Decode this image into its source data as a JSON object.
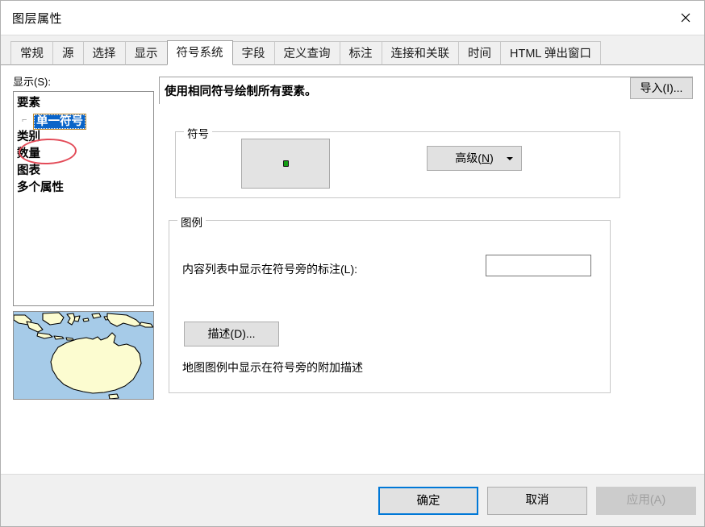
{
  "window": {
    "title": "图层属性",
    "close_icon": "close-icon"
  },
  "tabs": [
    {
      "label": "常规",
      "active": false
    },
    {
      "label": "源",
      "active": false
    },
    {
      "label": "选择",
      "active": false
    },
    {
      "label": "显示",
      "active": false
    },
    {
      "label": "符号系统",
      "active": true
    },
    {
      "label": "字段",
      "active": false
    },
    {
      "label": "定义查询",
      "active": false
    },
    {
      "label": "标注",
      "active": false
    },
    {
      "label": "连接和关联",
      "active": false
    },
    {
      "label": "时间",
      "active": false
    },
    {
      "label": "HTML 弹出窗口",
      "active": false
    }
  ],
  "left_panel": {
    "list_label": "显示(S):",
    "tree": [
      {
        "label": "要素",
        "type": "node",
        "selected": false
      },
      {
        "label": "单一符号",
        "type": "child",
        "selected": true
      },
      {
        "label": "类别",
        "type": "node",
        "selected": false
      },
      {
        "label": "数量",
        "type": "node",
        "selected": false,
        "annotated": true
      },
      {
        "label": "图表",
        "type": "node",
        "selected": false
      },
      {
        "label": "多个属性",
        "type": "node",
        "selected": false
      }
    ],
    "annotation_color": "#e34b58",
    "map_preview": {
      "name": "map-thumbnail",
      "ocean_color": "#a6cbe8",
      "land_color": "#fcfcd0",
      "outline_color": "#000000"
    }
  },
  "main_panel": {
    "render_description": "使用相同符号绘制所有要素。",
    "import_button": "导入(I)...",
    "symbol_group": {
      "title": "符号",
      "symbol_color": "#139d13",
      "symbol_outline": "#141414",
      "advanced_button": "高级(N)",
      "advanced_dropdown_icon": "chevron-down-icon"
    },
    "legend_group": {
      "title": "图例",
      "label_text": "内容列表中显示在符号旁的标注(L):",
      "label_input_value": "",
      "description_button": "描述(D)...",
      "description_text": "地图图例中显示在符号旁的附加描述"
    }
  },
  "footer": {
    "ok_button": "确定",
    "cancel_button": "取消",
    "apply_button": "应用(A)",
    "focus_color": "#0078d7"
  }
}
